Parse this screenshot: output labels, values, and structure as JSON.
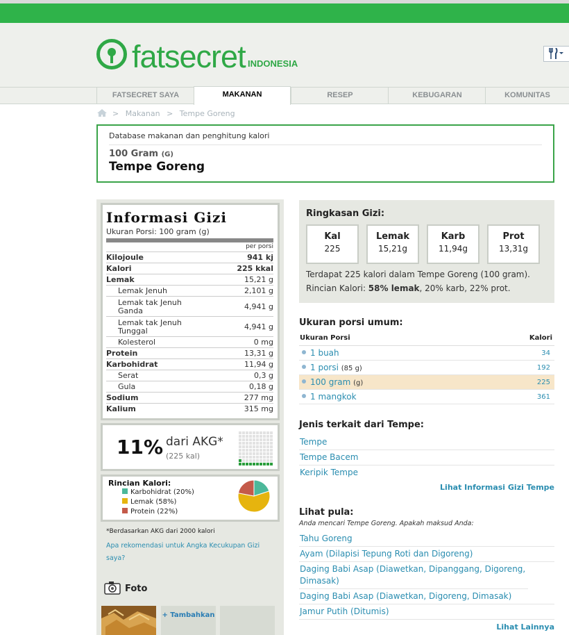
{
  "brand": {
    "name": "fatsecret",
    "country": "INDONESIA"
  },
  "nav": {
    "tabs": [
      "FATSECRET SAYA",
      "MAKANAN",
      "RESEP",
      "KEBUGARAN",
      "KOMUNITAS"
    ]
  },
  "breadcrumb": {
    "items": [
      "Makanan",
      "Tempe Goreng"
    ]
  },
  "food": {
    "db_label": "Database makanan dan penghitung kalori",
    "amount": "100 Gram",
    "unit": "(G)",
    "name": "Tempe Goreng"
  },
  "nutrition": {
    "title": "Informasi Gizi",
    "portion": "Ukuran Porsi: 100 gram (g)",
    "per": "per porsi",
    "rows": [
      {
        "label": "Kilojoule",
        "value": "941 kj"
      },
      {
        "label": "Kalori",
        "value": "225 kkal"
      },
      {
        "label": "Lemak",
        "value": "15,21 g"
      },
      {
        "label": "Lemak Jenuh",
        "value": "2,101 g"
      },
      {
        "label": "Lemak tak Jenuh Ganda",
        "value": "4,941 g"
      },
      {
        "label": "Lemak tak Jenuh Tunggal",
        "value": "4,941 g"
      },
      {
        "label": "Kolesterol",
        "value": "0 mg"
      },
      {
        "label": "Protein",
        "value": "13,31 g"
      },
      {
        "label": "Karbohidrat",
        "value": "11,94 g"
      },
      {
        "label": "Serat",
        "value": "0,3 g"
      },
      {
        "label": "Gula",
        "value": "0,18 g"
      },
      {
        "label": "Sodium",
        "value": "277 mg"
      },
      {
        "label": "Kalium",
        "value": "315 mg"
      }
    ]
  },
  "akg": {
    "percent": "11%",
    "text": "dari AKG*",
    "kal": "(225 kal)",
    "fill_fraction": 0.11
  },
  "breakdown": {
    "title": "Rincian Kalori:",
    "items": [
      {
        "label": "Karbohidrat (20%)",
        "color": "#4cb89a",
        "pct": 20
      },
      {
        "label": "Lemak (58%)",
        "color": "#e6b40e",
        "pct": 58
      },
      {
        "label": "Protein (22%)",
        "color": "#c45a4a",
        "pct": 22
      }
    ]
  },
  "akg_note": "*Berdasarkan AKG dari 2000 kalori",
  "akg_question": "Apa rekomendasi untuk Angka Kecukupan Gizi saya?",
  "photo": {
    "title": "Foto",
    "add_label": "+ Tambahkan"
  },
  "summary": {
    "title": "Ringkasan Gizi:",
    "cards": [
      {
        "label": "Kal",
        "value": "225"
      },
      {
        "label": "Lemak",
        "value": "15,21g"
      },
      {
        "label": "Karb",
        "value": "11,94g"
      },
      {
        "label": "Prot",
        "value": "13,31g"
      }
    ],
    "line1": "Terdapat 225 kalori dalam Tempe Goreng (100 gram).",
    "line2_prefix": "Rincian Kalori: ",
    "line2_bold": "58% lemak",
    "line2_suffix": ", 20% karb, 22% prot."
  },
  "portions": {
    "title": "Ukuran porsi umum:",
    "col_portion": "Ukuran Porsi",
    "col_cal": "Kalori",
    "rows": [
      {
        "label": "1 buah",
        "unit": "",
        "cal": "34"
      },
      {
        "label": "1 porsi",
        "unit": "(85 g)",
        "cal": "192"
      },
      {
        "label": "100 gram",
        "unit": "(g)",
        "cal": "225"
      },
      {
        "label": "1 mangkok",
        "unit": "",
        "cal": "361"
      }
    ]
  },
  "related": {
    "title": "Jenis terkait dari Tempe:",
    "items": [
      "Tempe",
      "Tempe Bacem",
      "Keripik Tempe"
    ],
    "more": "Lihat Informasi Gizi Tempe"
  },
  "see_also": {
    "title": "Lihat pula:",
    "hint": "Anda mencari Tempe Goreng. Apakah maksud Anda:",
    "items": [
      "Tahu Goreng",
      "Ayam (Dilapisi Tepung Roti dan Digoreng)",
      "Daging Babi Asap (Diawetkan, Dipanggang, Digoreng, Dimasak)",
      "Daging Babi Asap (Diawetkan, Digoreng, Dimasak)",
      "Jamur Putih (Ditumis)"
    ],
    "more": "Lihat Lainnya"
  }
}
